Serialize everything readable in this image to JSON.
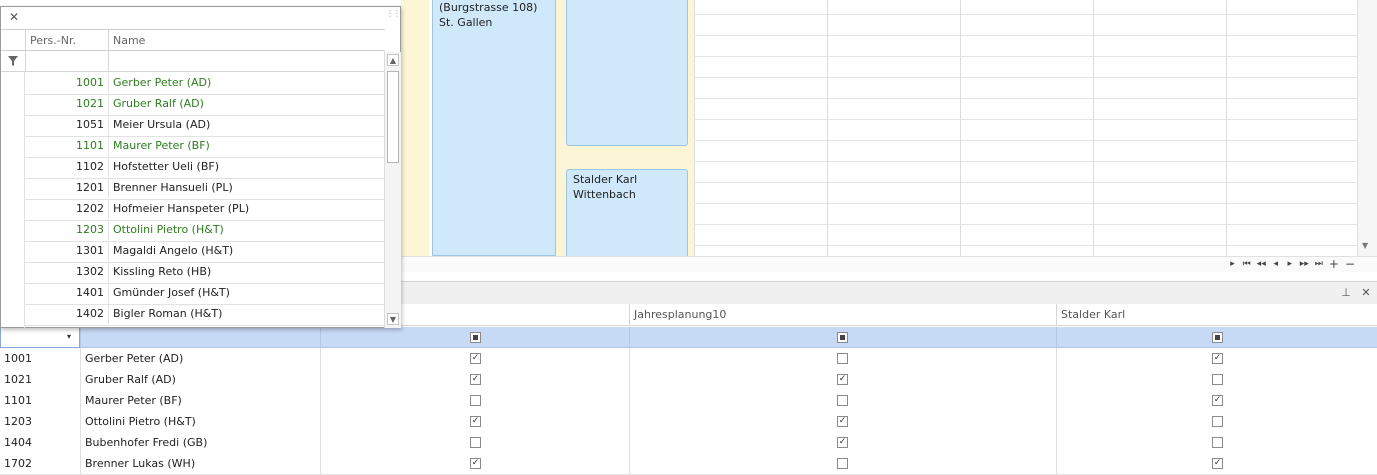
{
  "scheduler": {
    "appointments": [
      {
        "line1": "(Burgstrasse 108)",
        "line2": "St. Gallen"
      },
      {
        "line1": "Stalder Karl",
        "line2": "Wittenbach"
      }
    ],
    "nav_icons": [
      "nav-right-icon",
      "nav-first-icon",
      "nav-prev-page-icon",
      "nav-prev-icon",
      "nav-next-icon",
      "nav-next-page-icon",
      "nav-last-icon",
      "add-icon",
      "remove-icon"
    ]
  },
  "lookup": {
    "columns": {
      "id": "Pers.-Nr.",
      "name": "Name"
    },
    "rows": [
      {
        "id": "1001",
        "name": "Gerber Peter (AD)",
        "highlight": true
      },
      {
        "id": "1021",
        "name": "Gruber Ralf (AD)",
        "highlight": true
      },
      {
        "id": "1051",
        "name": "Meier Ursula (AD)",
        "highlight": false
      },
      {
        "id": "1101",
        "name": "Maurer Peter (BF)",
        "highlight": true
      },
      {
        "id": "1102",
        "name": "Hofstetter Ueli (BF)",
        "highlight": false
      },
      {
        "id": "1201",
        "name": "Brenner Hansueli (PL)",
        "highlight": false
      },
      {
        "id": "1202",
        "name": "Hofmeier Hanspeter (PL)",
        "highlight": false
      },
      {
        "id": "1203",
        "name": "Ottolini Pietro (H&T)",
        "highlight": true
      },
      {
        "id": "1301",
        "name": "Magaldi Angelo (H&T)",
        "highlight": false
      },
      {
        "id": "1302",
        "name": "Kissling Reto (HB)",
        "highlight": false
      },
      {
        "id": "1401",
        "name": "Gmünder Josef (H&T)",
        "highlight": false
      },
      {
        "id": "1402",
        "name": "Bigler Roman (H&T)",
        "highlight": false
      }
    ],
    "colors": {
      "highlight": "#2e7d1e"
    }
  },
  "grid": {
    "columns": [
      "",
      "",
      "",
      "Jahresplanung10",
      "Stalder Karl"
    ],
    "rows": [
      {
        "id": "1001",
        "name": "Gerber Peter (AD)",
        "checks": [
          true,
          false,
          true
        ]
      },
      {
        "id": "1021",
        "name": "Gruber Ralf (AD)",
        "checks": [
          true,
          true,
          false
        ]
      },
      {
        "id": "1101",
        "name": "Maurer Peter (BF)",
        "checks": [
          false,
          false,
          true
        ]
      },
      {
        "id": "1203",
        "name": "Ottolini Pietro (H&T)",
        "checks": [
          true,
          true,
          false
        ]
      },
      {
        "id": "1404",
        "name": "Bubenhofer Fredi (GB)",
        "checks": [
          false,
          true,
          false
        ]
      },
      {
        "id": "1702",
        "name": "Brenner Lukas (WH)",
        "checks": [
          true,
          false,
          true
        ]
      }
    ],
    "colors": {
      "filter_row": "#c7daf5"
    }
  }
}
